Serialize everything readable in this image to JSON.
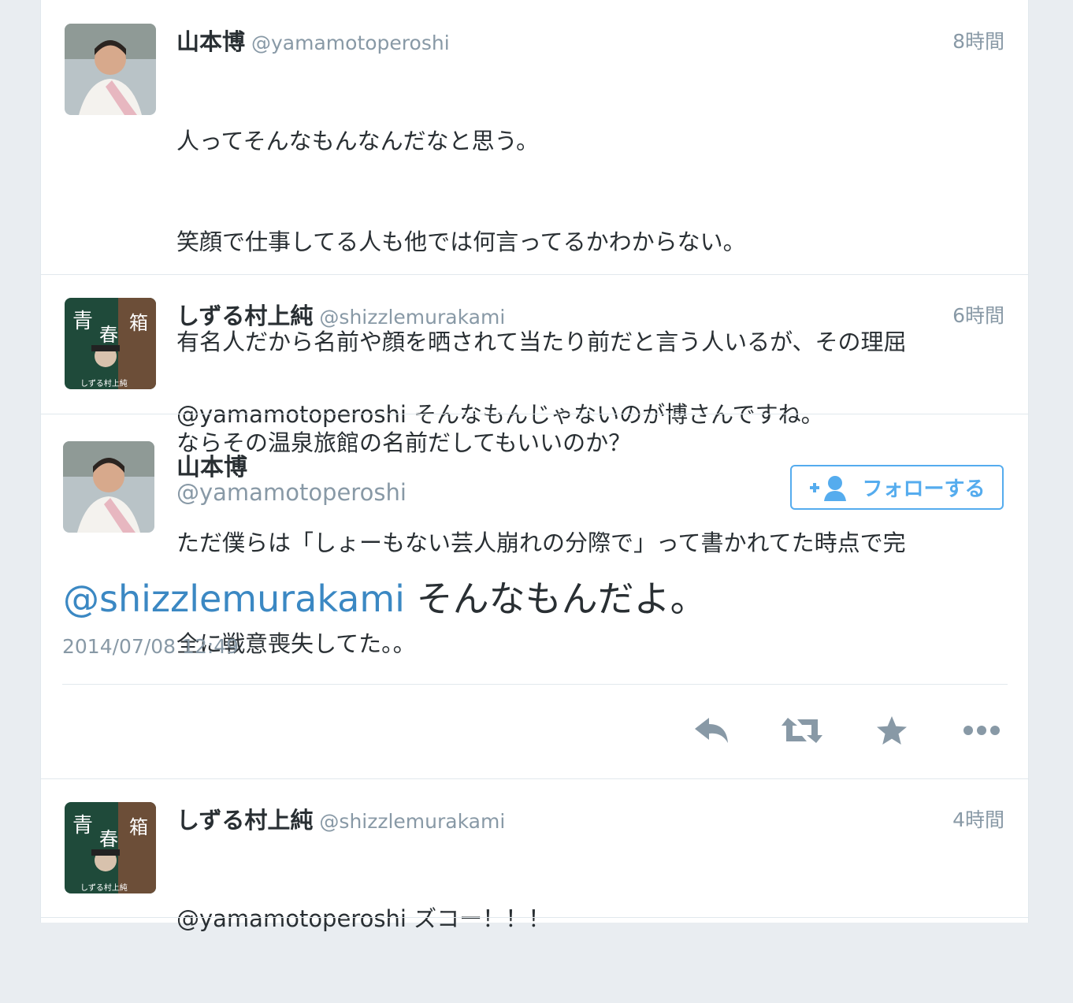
{
  "colors": {
    "name": "#292f33",
    "meta": "#8899a6",
    "mention": "#3b88c3",
    "follow": "#55acee",
    "icons": "#8899a6"
  },
  "tweets": [
    {
      "name": "山本博",
      "handle": "@yamamotoperoshi",
      "time": "8時間",
      "lines": [
        "人ってそんなもんなんだなと思う。",
        "笑顔で仕事してる人も他では何言ってるかわからない。",
        "有名人だから名前や顔を晒されて当たり前だと言う人いるが、その理屈",
        "ならその温泉旅館の名前だしてもいいのか？",
        "ただ僕らは「しょーもない芸人崩れの分際で」って書かれてた時点で完",
        "全に戦意喪失してた。。"
      ]
    },
    {
      "name": "しずる村上純",
      "handle": "@shizzlemurakami",
      "time": "6時間",
      "lines": [
        "@yamamotoperoshi そんなもんじゃないのが博さんですね。"
      ]
    }
  ],
  "main_tweet": {
    "name": "山本博",
    "handle": "@yamamotoperoshi",
    "follow_label": "フォローする",
    "mention": "@shizzlemurakami",
    "text": " そんなもんだよ。",
    "date": "2014/07/08 12:49",
    "actions": [
      "reply-icon",
      "retweet-icon",
      "favorite-icon",
      "more-icon"
    ]
  },
  "reply": {
    "name": "しずる村上純",
    "handle": "@shizzlemurakami",
    "time": "4時間",
    "text": "@yamamotoperoshi ズコー！！！"
  }
}
